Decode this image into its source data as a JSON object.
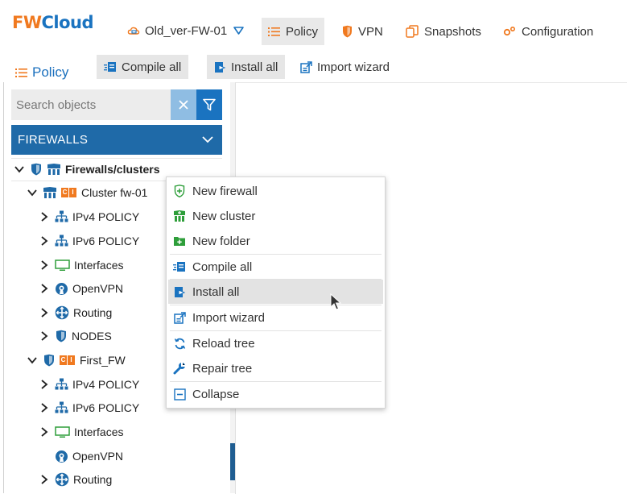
{
  "app": {
    "logo_fw": "FW",
    "logo_cloud": "Cloud",
    "selected_firewall": "Old_ver-FW-01"
  },
  "nav": {
    "tabs": [
      {
        "label": "Policy",
        "icon": "list-icon",
        "active": true
      },
      {
        "label": "VPN",
        "icon": "shield-icon"
      },
      {
        "label": "Snapshots",
        "icon": "copy-icon"
      },
      {
        "label": "Configuration",
        "icon": "cog-icon"
      }
    ]
  },
  "toolbar": {
    "section_label": "Policy",
    "compile_all": "Compile all",
    "install_all": "Install all",
    "import_wizard": "Import wizard"
  },
  "search": {
    "placeholder": "Search objects"
  },
  "panel": {
    "header": "FIREWALLS"
  },
  "tree": {
    "root": "Firewalls/clusters",
    "items": [
      {
        "label": "Cluster fw-01",
        "badge": "CI",
        "icon": "cluster-icon"
      },
      {
        "label": "IPv4 POLICY",
        "icon": "network-icon"
      },
      {
        "label": "IPv6 POLICY",
        "icon": "network-icon"
      },
      {
        "label": "Interfaces",
        "icon": "monitor-icon"
      },
      {
        "label": "OpenVPN",
        "icon": "openvpn-icon"
      },
      {
        "label": "Routing",
        "icon": "routing-icon"
      },
      {
        "label": "NODES",
        "icon": "shield-icon"
      },
      {
        "label": "First_FW",
        "badge": "CI",
        "icon": "shield-icon"
      },
      {
        "label": "IPv4 POLICY",
        "icon": "network-icon"
      },
      {
        "label": "IPv6 POLICY",
        "icon": "network-icon"
      },
      {
        "label": "Interfaces",
        "icon": "monitor-icon"
      },
      {
        "label": "OpenVPN",
        "icon": "openvpn-icon"
      },
      {
        "label": "Routing",
        "icon": "routing-icon"
      }
    ]
  },
  "context_menu": {
    "items": [
      {
        "label": "New firewall",
        "icon": "shield-plus-icon"
      },
      {
        "label": "New cluster",
        "icon": "cluster-plus-icon"
      },
      {
        "label": "New folder",
        "icon": "folder-plus-icon"
      },
      {
        "label": "Compile all",
        "icon": "compile-icon"
      },
      {
        "label": "Install all",
        "icon": "install-icon",
        "hovered": true
      },
      {
        "label": "Import wizard",
        "icon": "import-icon"
      },
      {
        "label": "Reload tree",
        "icon": "reload-icon"
      },
      {
        "label": "Repair tree",
        "icon": "wrench-icon"
      },
      {
        "label": "Collapse",
        "icon": "collapse-icon"
      }
    ]
  },
  "colors": {
    "accent_blue": "#1a73c0",
    "header_blue": "#1f6aa8",
    "brand_orange": "#f0791f",
    "green": "#2e9e3a"
  }
}
